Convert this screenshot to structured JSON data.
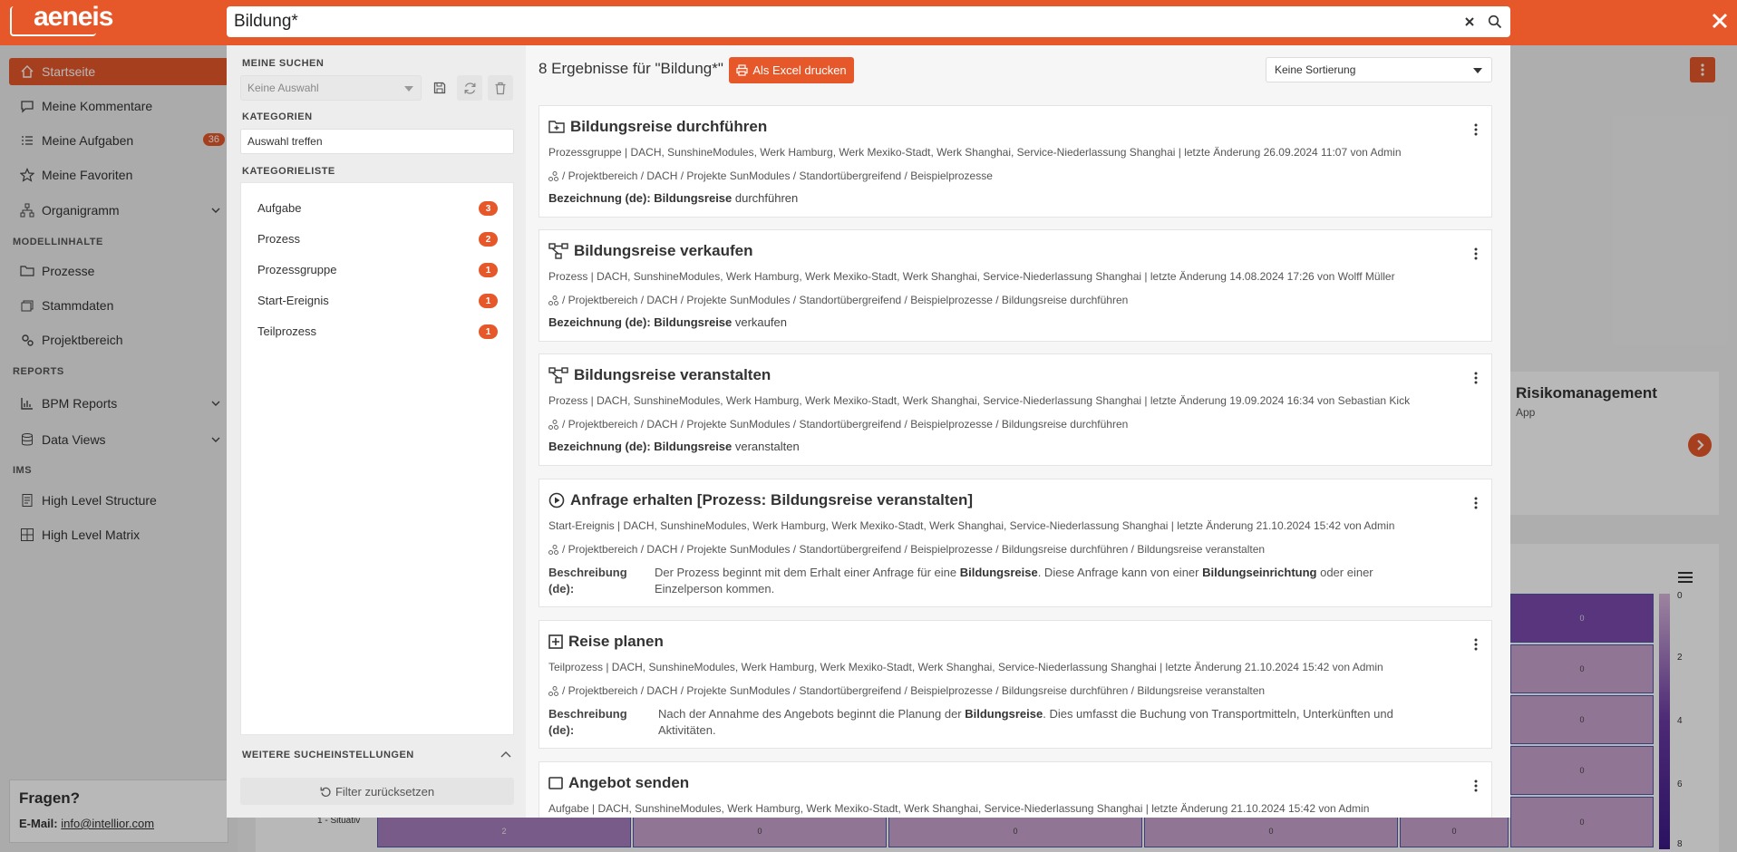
{
  "brand": {
    "logo_text": "aeneis"
  },
  "search": {
    "value": "Bildung*"
  },
  "sidebar": {
    "items": [
      {
        "label": "Startseite"
      },
      {
        "label": "Meine Kommentare"
      },
      {
        "label": "Meine Aufgaben",
        "badge": "36"
      },
      {
        "label": "Meine Favoriten"
      },
      {
        "label": "Organigramm"
      },
      {
        "label": "Prozesse"
      },
      {
        "label": "Stammdaten"
      },
      {
        "label": "Projektbereich"
      },
      {
        "label": "BPM Reports"
      },
      {
        "label": "Data Views"
      },
      {
        "label": "High Level Structure"
      },
      {
        "label": "High Level Matrix"
      }
    ],
    "sections": [
      "MODELLINHALTE",
      "REPORTS",
      "IMS"
    ],
    "help": {
      "title": "Fragen?",
      "email_label": "E-Mail:",
      "email": "info@intellior.com"
    }
  },
  "background": {
    "tile_title": "Risikomanagement",
    "tile_sub": "App",
    "heat_row_label": "1 - Situativ",
    "legend_ticks": [
      "0",
      "2",
      "4",
      "6",
      "8"
    ],
    "cells": [
      "0",
      "0",
      "0",
      "0",
      "0",
      "2",
      "0",
      "0",
      "0",
      "0"
    ]
  },
  "filters": {
    "saved_heading": "MEINE SUCHEN",
    "saved_placeholder": "Keine Auswahl",
    "categories_heading": "KATEGORIEN",
    "categories_placeholder": "Auswahl treffen",
    "list_heading": "KATEGORIELISTE",
    "list": [
      {
        "label": "Aufgabe",
        "count": "3"
      },
      {
        "label": "Prozess",
        "count": "2"
      },
      {
        "label": "Prozessgruppe",
        "count": "1"
      },
      {
        "label": "Start-Ereignis",
        "count": "1"
      },
      {
        "label": "Teilprozess",
        "count": "1"
      }
    ],
    "more_settings": "WEITERE SUCHEINSTELLUNGEN",
    "reset": "Filter zurücksetzen"
  },
  "results": {
    "count_text": "8 Ergebnisse für \"Bildung*\"",
    "excel_label": "Als Excel drucken",
    "sort_label": "Keine Sortierung",
    "cards": [
      {
        "title": "Bildungsreise durchführen",
        "meta": "Prozessgruppe | DACH, SunshineModules, Werk Hamburg, Werk Mexiko-Stadt, Werk Shanghai, Service-Niederlassung Shanghai | letzte Änderung 26.09.2024 11:07 von Admin",
        "path": "/ Projektbereich / DACH / Projekte SunModules / Standortübergreifend / Beispielprozesse",
        "field_label": "Bezeichnung (de):",
        "field_bold": "Bildungsreise",
        "field_rest": " durchführen"
      },
      {
        "title": "Bildungsreise verkaufen",
        "meta": "Prozess | DACH, SunshineModules, Werk Hamburg, Werk Mexiko-Stadt, Werk Shanghai, Service-Niederlassung Shanghai | letzte Änderung 14.08.2024 17:26 von Wolff Müller",
        "path": "/ Projektbereich / DACH / Projekte SunModules / Standortübergreifend / Beispielprozesse / Bildungsreise durchführen",
        "field_label": "Bezeichnung (de):",
        "field_bold": "Bildungsreise",
        "field_rest": " verkaufen"
      },
      {
        "title": "Bildungsreise veranstalten",
        "meta": "Prozess | DACH, SunshineModules, Werk Hamburg, Werk Mexiko-Stadt, Werk Shanghai, Service-Niederlassung Shanghai | letzte Änderung 19.09.2024 16:34 von Sebastian Kick",
        "path": "/ Projektbereich / DACH / Projekte SunModules / Standortübergreifend / Beispielprozesse / Bildungsreise durchführen",
        "field_label": "Bezeichnung (de):",
        "field_bold": "Bildungsreise",
        "field_rest": " veranstalten"
      },
      {
        "title": "Anfrage erhalten [Prozess: Bildungsreise veranstalten]",
        "meta": "Start-Ereignis | DACH, SunshineModules, Werk Hamburg, Werk Mexiko-Stadt, Werk Shanghai, Service-Niederlassung Shanghai | letzte Änderung 21.10.2024 15:42 von Admin",
        "path": "/ Projektbereich / DACH / Projekte SunModules / Standortübergreifend / Beispielprozesse / Bildungsreise durchführen / Bildungsreise veranstalten",
        "desc_label_1": "Beschreibung",
        "desc_label_2": "(de):",
        "desc_a": "Der Prozess beginnt mit dem Erhalt einer Anfrage für eine ",
        "desc_b": "Bildungsreise",
        "desc_c": ". Diese Anfrage kann von einer ",
        "desc_d": "Bildungseinrichtung",
        "desc_e": " oder einer",
        "desc_f": "Einzelperson kommen."
      },
      {
        "title": "Reise planen",
        "meta": "Teilprozess | DACH, SunshineModules, Werk Hamburg, Werk Mexiko-Stadt, Werk Shanghai, Service-Niederlassung Shanghai | letzte Änderung 21.10.2024 15:42 von Admin",
        "path": "/ Projektbereich / DACH / Projekte SunModules / Standortübergreifend / Beispielprozesse / Bildungsreise durchführen / Bildungsreise veranstalten",
        "desc_label_1": "Beschreibung",
        "desc_label_2": "(de):",
        "desc_a": "Nach der Annahme des Angebots beginnt die Planung der ",
        "desc_b": "Bildungsreise",
        "desc_c": ". Dies umfasst die Buchung von Transportmitteln, Unterkünften und",
        "desc_f": "Aktivitäten."
      },
      {
        "title": "Angebot senden",
        "meta": "Aufgabe | DACH, SunshineModules, Werk Hamburg, Werk Mexiko-Stadt, Werk Shanghai, Service-Niederlassung Shanghai | letzte Änderung 21.10.2024 15:42 von Admin"
      }
    ]
  },
  "colors": {
    "accent": "#e6582a",
    "heat_light": "#d6b3d8",
    "heat_dark": "#6a3aa3"
  }
}
